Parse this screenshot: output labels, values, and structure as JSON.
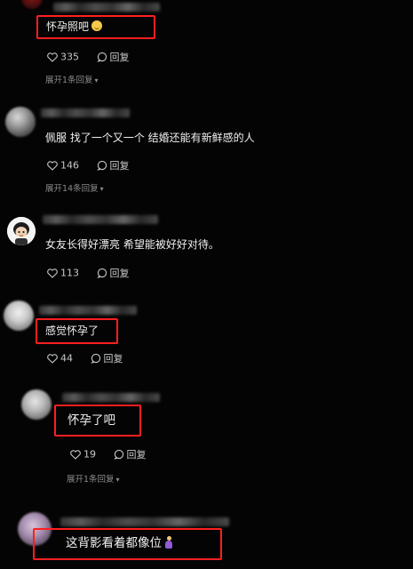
{
  "comments": [
    {
      "text": "怀孕照吧",
      "likes": "335",
      "reply_label": "回复",
      "expand_label": "展开1条回复",
      "has_emoji": "grinning-face"
    },
    {
      "text": "佩服 找了一个又一个 结婚还能有新鲜感的人",
      "likes": "146",
      "reply_label": "回复",
      "expand_label": "展开14条回复"
    },
    {
      "text": "女友长得好漂亮 希望能被好好对待。",
      "likes": "113",
      "reply_label": "回复"
    },
    {
      "text": "感觉怀孕了",
      "likes": "44",
      "reply_label": "回复"
    },
    {
      "text": "怀孕了吧",
      "likes": "19",
      "reply_label": "回复",
      "expand_label": "展开1条回复"
    },
    {
      "text": "这背影看着都像位",
      "has_emoji": "pregnant-person"
    }
  ],
  "colors": {
    "background": "#040404",
    "highlight": "#ff1f1f",
    "text": "#f0f0f0",
    "muted": "#8b8b8b"
  }
}
